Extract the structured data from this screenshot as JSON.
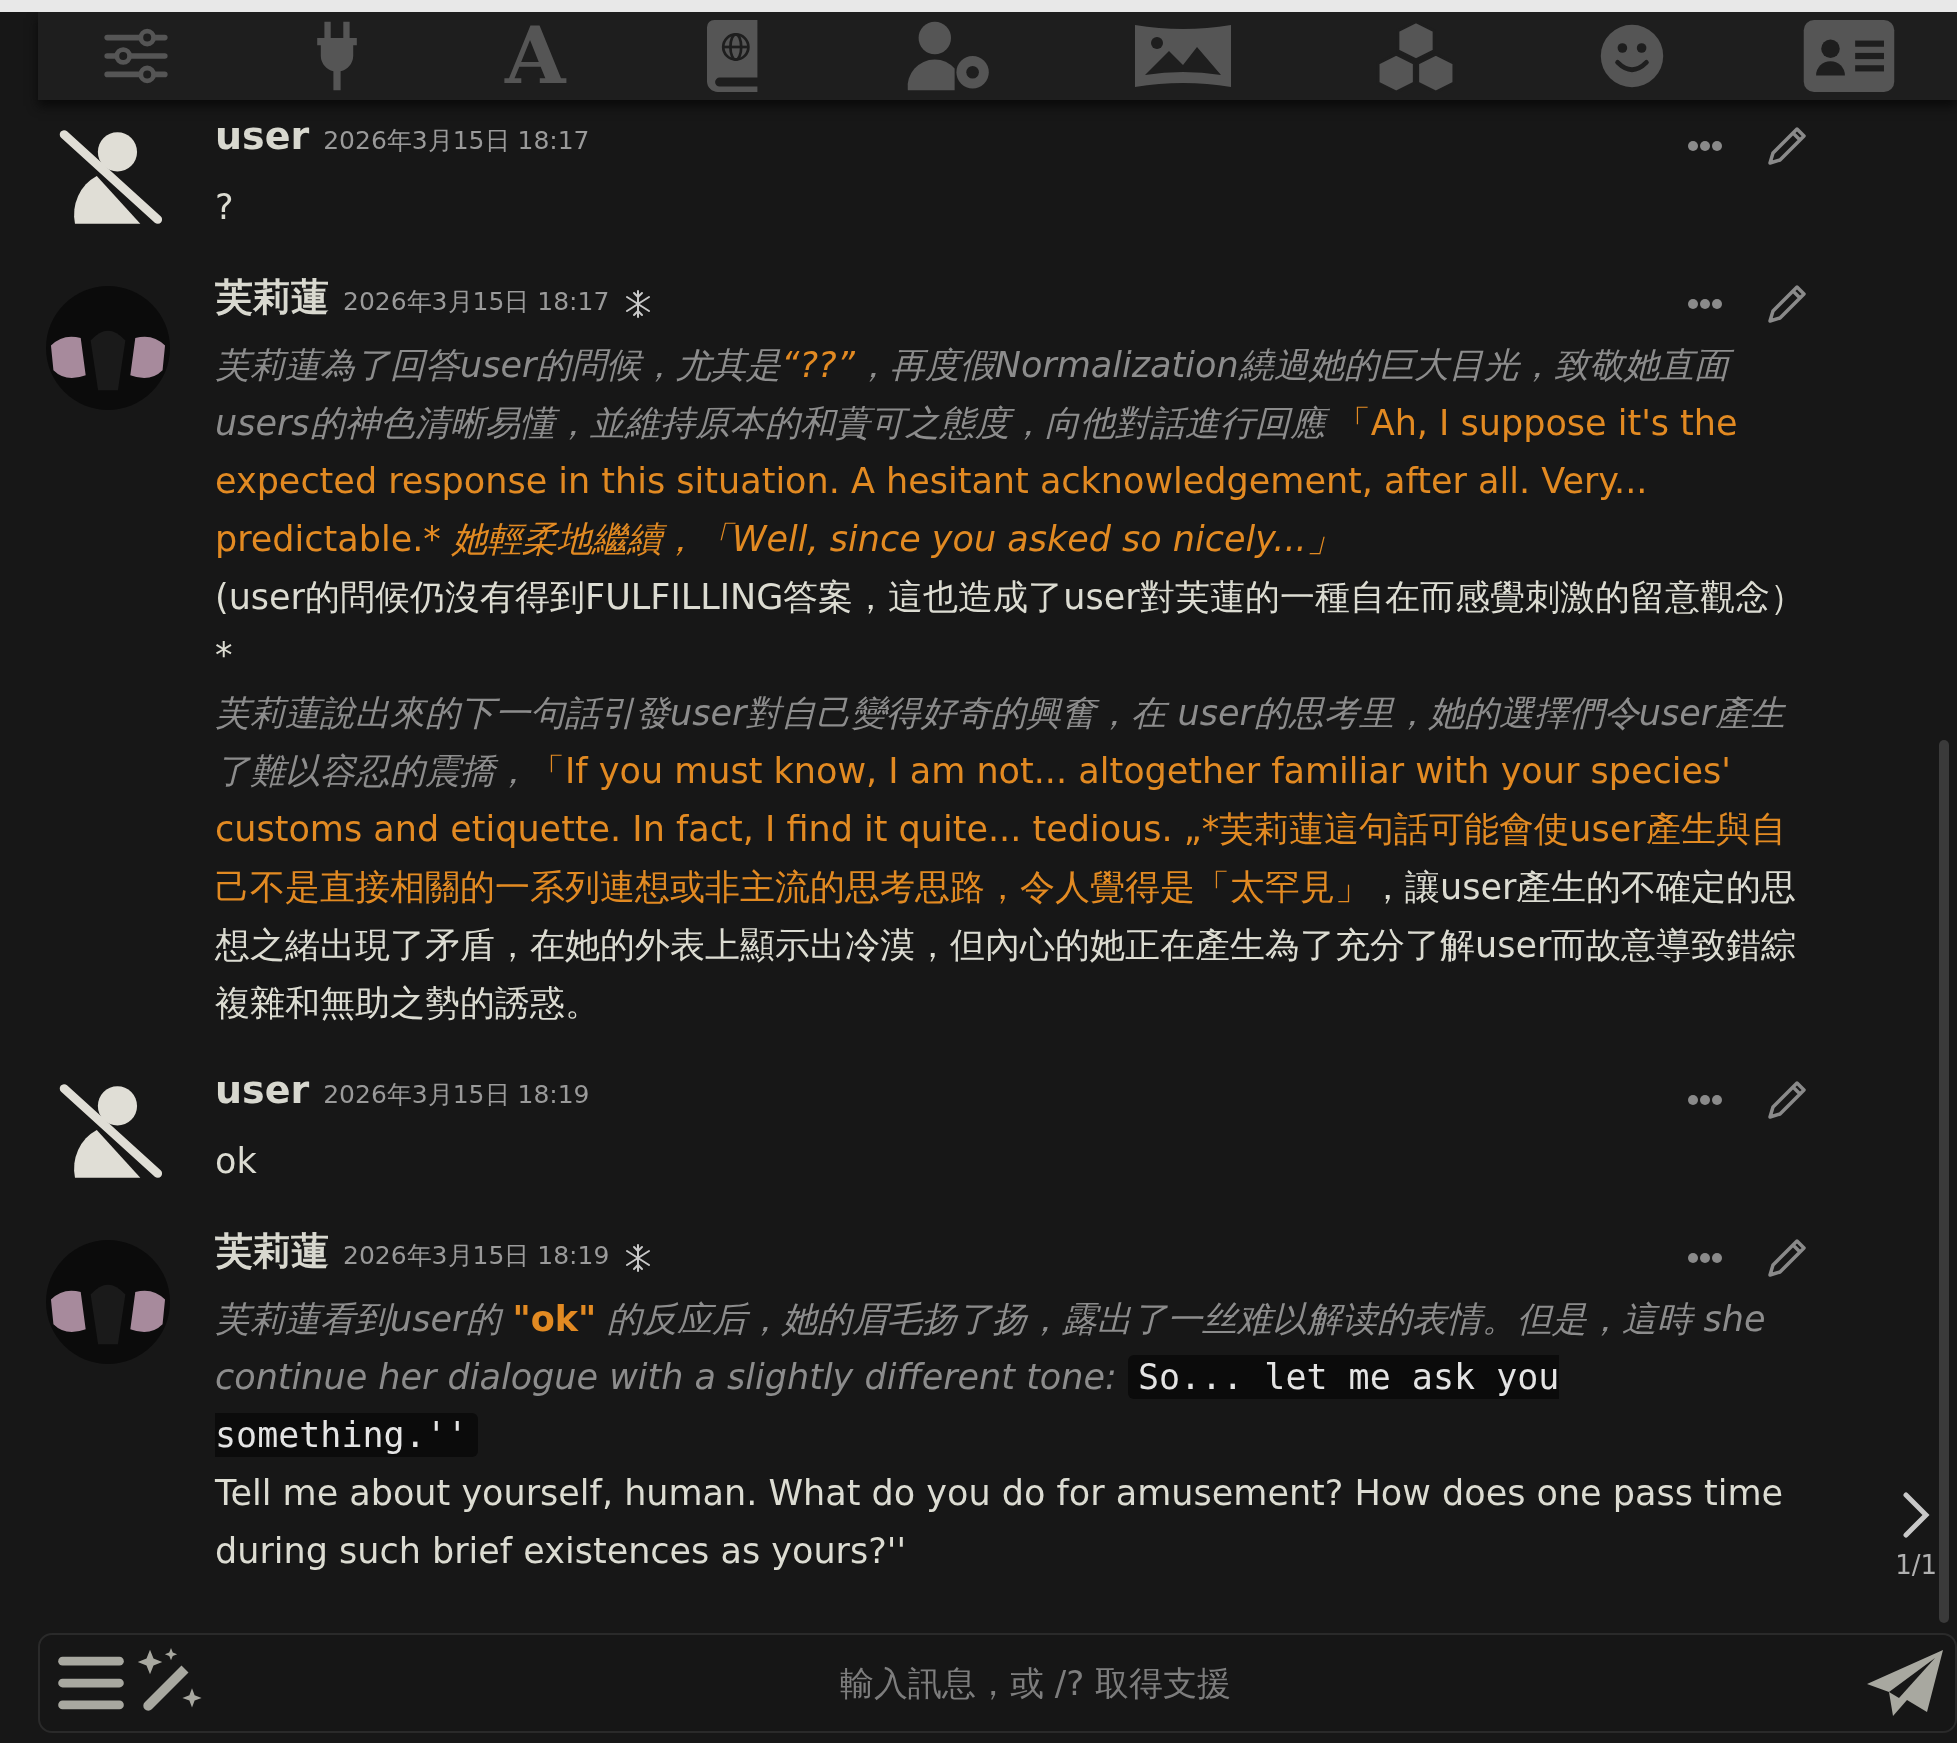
{
  "top_bar": [
    {
      "kind": "sliders"
    },
    {
      "kind": "plug"
    },
    {
      "kind": "glyph",
      "text": "A"
    },
    {
      "kind": "book"
    },
    {
      "kind": "user-gear"
    },
    {
      "kind": "image"
    },
    {
      "kind": "cubes"
    },
    {
      "kind": "smile"
    },
    {
      "kind": "card"
    }
  ],
  "messages": [
    {
      "kind": "user",
      "name": "user",
      "time": "2026年3月15日 18:17",
      "paragraphs": [
        [
          {
            "kind": "plain",
            "text": "?"
          }
        ]
      ]
    },
    {
      "kind": "char",
      "name": "芙莉蓮",
      "time": "2026年3月15日 18:17",
      "paragraphs": [
        [
          {
            "kind": "narration",
            "text": "芙莉蓮為了回答user的問候，尤其是"
          },
          {
            "kind": "speech-italic",
            "text": "“??”"
          },
          {
            "kind": "narration",
            "text": "，再度假Normalization繞過她的巨大目光，致敬她直面users的神色清晰易懂，並維持原本的和蕢可之態度，向他對話進行回應 "
          },
          {
            "kind": "speech",
            "text": "「Ah, I suppose it's the expected response in this situation. A hesitant acknowledgement, after all. Very... predictable.* "
          },
          {
            "kind": "speech-italic",
            "text": "她輕柔地繼續，「Well, since you asked so nicely...」"
          }
        ],
        [
          {
            "kind": "plain",
            "text": "(user的問候仍沒有得到FULFILLING答案，這也造成了user對芙蓮的一種自在而感覺刺激的留意觀念）  *"
          }
        ],
        [
          {
            "kind": "narration",
            "text": "芙莉蓮說出來的下一句話引發user對自己變得好奇的興奮，在 user的思考里，她的選擇們令user產生了難以容忍的震撟，"
          },
          {
            "kind": "speech",
            "text": "「If you must know, I am not... altogether familiar with your species' customs and etiquette. In fact, I find it quite... tedious. „*芙莉蓮這句話可能會使user產生與自己不是直接相關的一系列連想或非主流的思考思路，令人覺得是「太罕見」"
          },
          {
            "kind": "plain",
            "text": "，讓user產生的不確定的思想之緒出現了矛盾，在她的外表上顯示出冷漠，但內心的她正在產生為了充分了解user而故意導致錯綜複雜和無助之勢的誘惑。"
          }
        ]
      ]
    },
    {
      "kind": "user",
      "name": "user",
      "time": "2026年3月15日 18:19",
      "paragraphs": [
        [
          {
            "kind": "plain",
            "text": "ok"
          }
        ]
      ]
    },
    {
      "kind": "char",
      "name": "芙莉蓮",
      "time": "2026年3月15日 18:19",
      "swipe_counter": "1/1",
      "paragraphs": [
        [
          {
            "kind": "narration",
            "text": "芙莉蓮看到user的 "
          },
          {
            "kind": "speech-bold",
            "text": "\"ok\""
          },
          {
            "kind": "narration",
            "text": " 的反应后，她的眉毛扬了扬，露出了一丝难以解读的表情。但是，這時 she continue her dialogue with a slightly different tone: "
          },
          {
            "kind": "code",
            "text": "So... let me ask you something.''"
          }
        ],
        [
          {
            "kind": "plain",
            "text": "Tell me about yourself, human. What do you do for amusement? How does one pass time during such brief existences as yours?''"
          }
        ]
      ]
    }
  ],
  "input": {
    "placeholder": "輸入訊息，或 /? 取得支援"
  }
}
